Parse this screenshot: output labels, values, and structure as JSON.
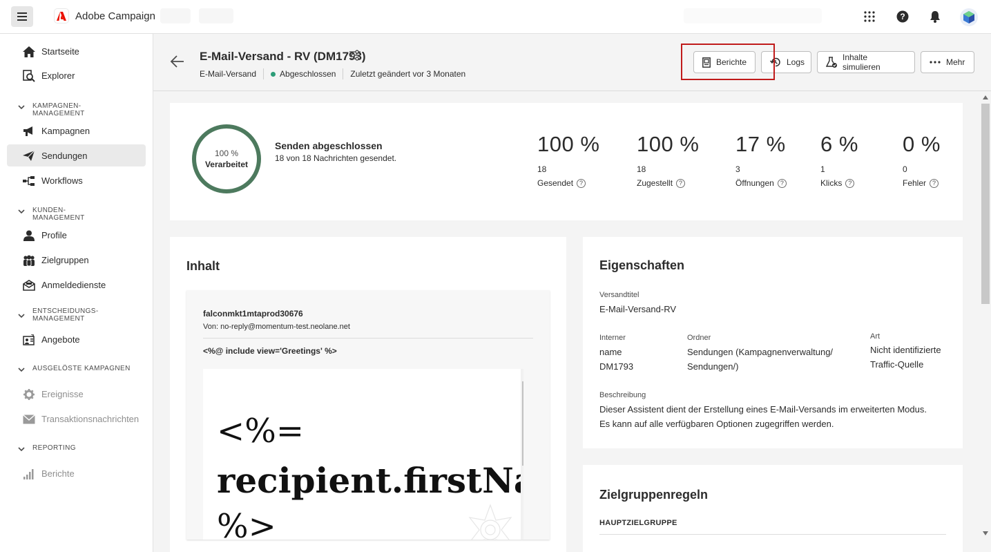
{
  "app": {
    "name": "Adobe Campaign"
  },
  "sidebar": {
    "items": [
      {
        "label": "Startseite",
        "icon": "home-icon"
      },
      {
        "label": "Explorer",
        "icon": "explorer-icon"
      },
      {
        "label": "Kampagnen",
        "icon": "megaphone-icon"
      },
      {
        "label": "Sendungen",
        "icon": "send-icon"
      },
      {
        "label": "Workflows",
        "icon": "workflow-icon"
      },
      {
        "label": "Profile",
        "icon": "user-icon"
      },
      {
        "label": "Zielgruppen",
        "icon": "audiences-icon"
      },
      {
        "label": "Anmeldedienste",
        "icon": "subscription-icon"
      },
      {
        "label": "Angebote",
        "icon": "offers-icon"
      },
      {
        "label": "Ereignisse",
        "icon": "gear-icon"
      },
      {
        "label": "Transaktionsnachrichten",
        "icon": "mail-icon"
      },
      {
        "label": "Berichte",
        "icon": "reports-icon"
      }
    ],
    "sections": [
      "KAMPAGNEN-MANAGEMENT",
      "KUNDEN-MANAGEMENT",
      "ENTSCHEIDUNGS-MANAGEMENT",
      "AUSGELÖSTE KAMPAGNEN",
      "REPORTING"
    ]
  },
  "header": {
    "title": "E-Mail-Versand - RV (DM1793)",
    "type": "E-Mail-Versand",
    "status": "Abgeschlossen",
    "modified": "Zuletzt geändert vor 3 Monaten",
    "buttons": {
      "reports": "Berichte",
      "logs": "Logs",
      "simulate": "Inhalte simulieren",
      "more": "Mehr"
    }
  },
  "stats": {
    "progress_pct": "100 %",
    "progress_label": "Verarbeitet",
    "title": "Senden abgeschlossen",
    "subtitle": "18 von 18 Nachrichten gesendet.",
    "kpis": [
      {
        "value": "100 %",
        "count": "18",
        "label": "Gesendet"
      },
      {
        "value": "100 %",
        "count": "18",
        "label": "Zugestellt"
      },
      {
        "value": "17 %",
        "count": "3",
        "label": "Öffnungen"
      },
      {
        "value": "6 %",
        "count": "1",
        "label": "Klicks"
      },
      {
        "value": "0 %",
        "count": "0",
        "label": "Fehler"
      }
    ]
  },
  "content": {
    "heading": "Inhalt",
    "sender": "falconmkt1mtaprod30676",
    "from": "Von: no-reply@momentum-test.neolane.net",
    "include": "<%@ include view='Greetings' %>",
    "body_lines": [
      "<%=",
      "recipient.firstName",
      "%>"
    ]
  },
  "properties": {
    "heading": "Eigenschaften",
    "title_label": "Versandtitel",
    "title_value": "E-Mail-Versand-RV",
    "internal_label_1": "Interner",
    "internal_label_2": "name",
    "internal_value": "DM1793",
    "folder_label": "Ordner",
    "folder_value_1": "Sendungen (Kampagnenverwaltung/",
    "folder_value_2": "Sendungen/)",
    "kind_label": "Art",
    "kind_value_1": "Nicht identifizierte",
    "kind_value_2": "Traffic-Quelle",
    "desc_label": "Beschreibung",
    "desc_value_1": "Dieser Assistent dient der Erstellung eines E-Mail-Versands im erweiterten Modus.",
    "desc_value_2": "Es kann auf alle verfügbaren Optionen zugegriffen werden."
  },
  "rules": {
    "heading": "Zielgruppenregeln",
    "main": "HAUPTZIELGRUPPE"
  }
}
